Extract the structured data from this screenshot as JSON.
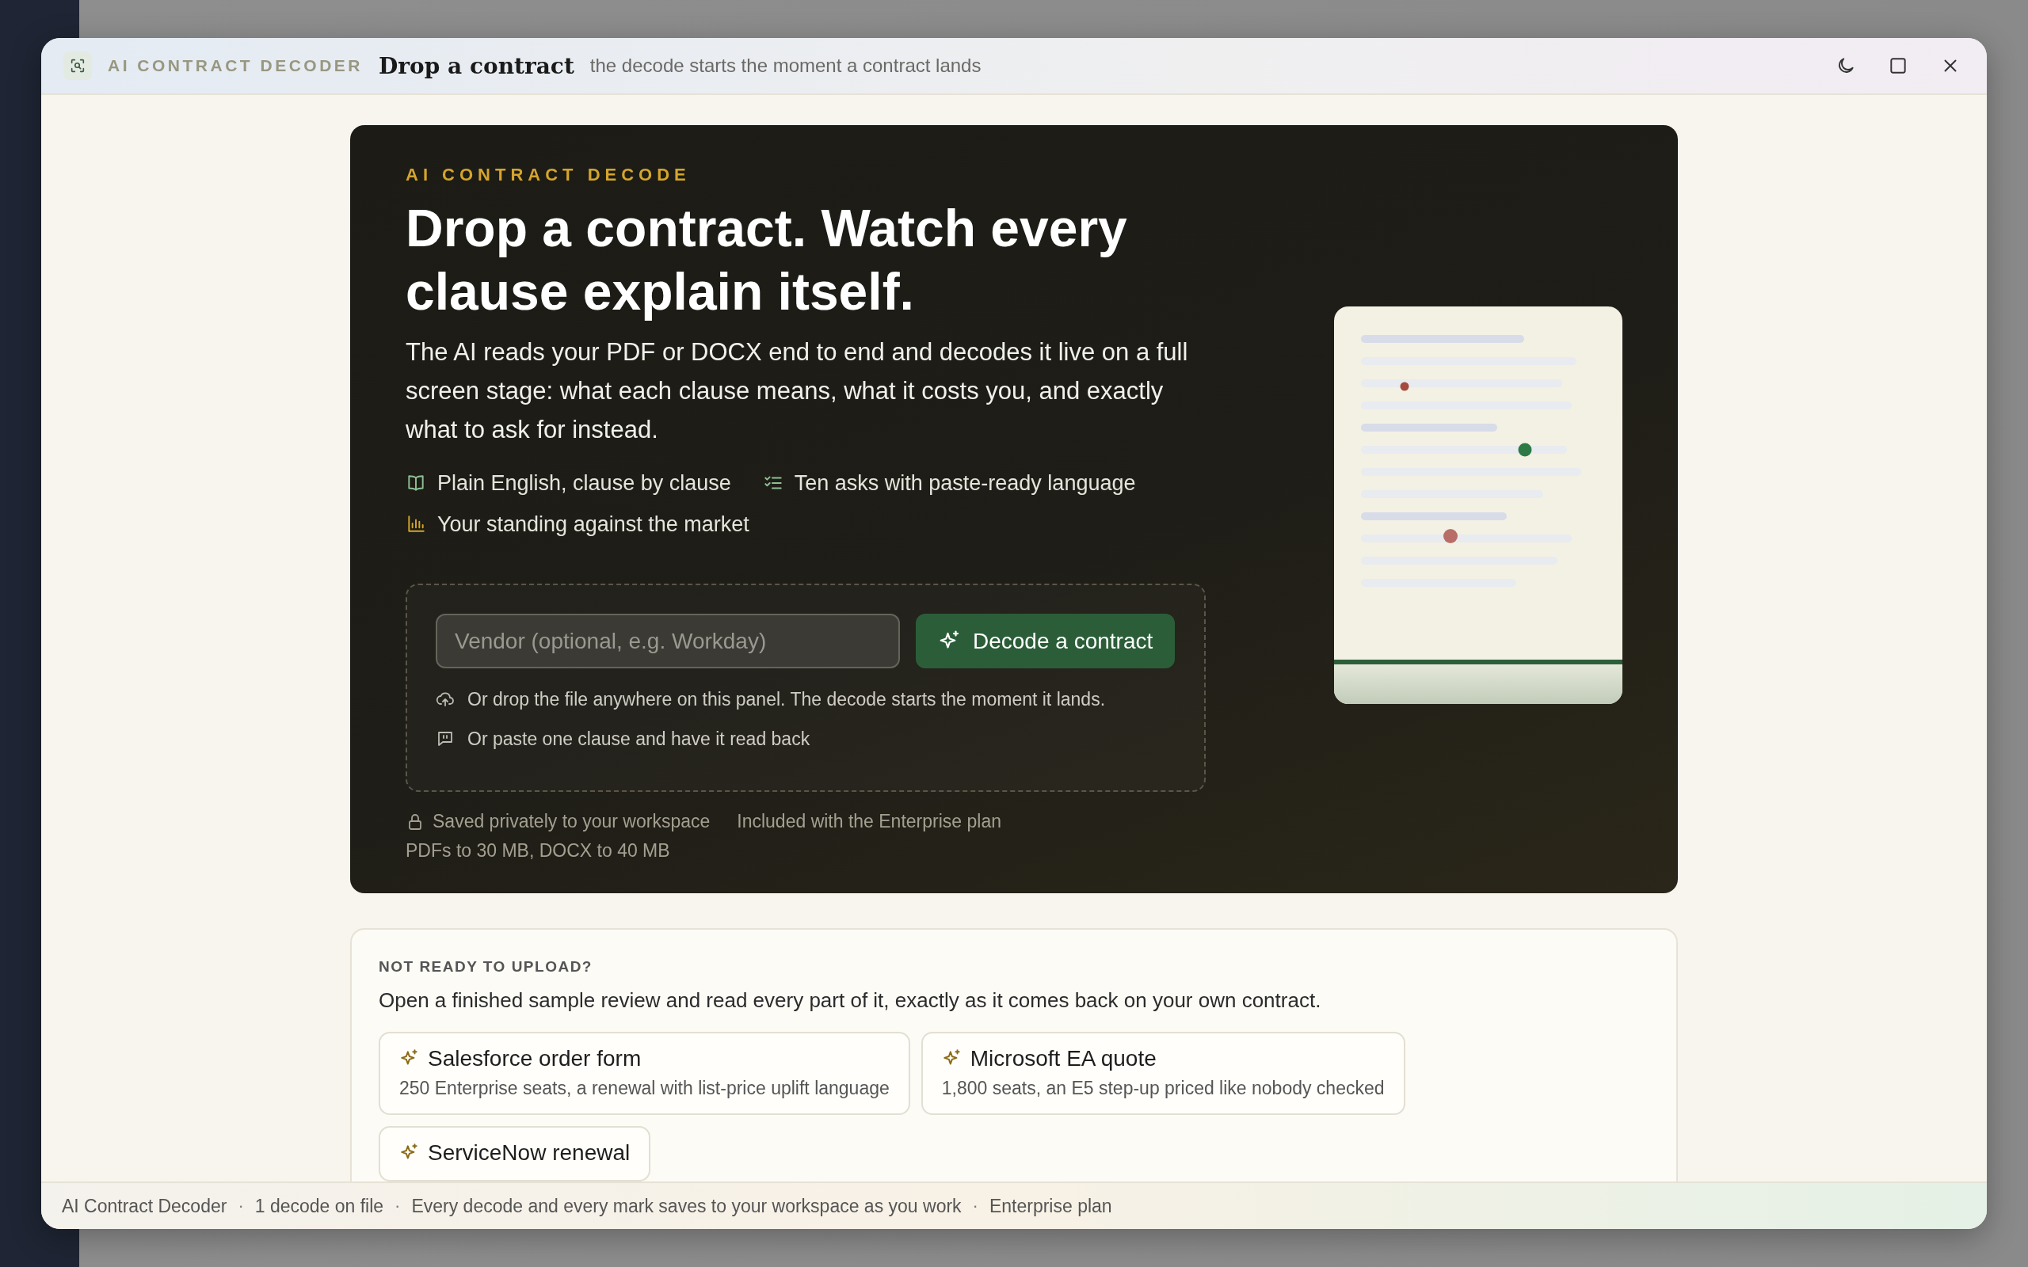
{
  "window": {
    "eyebrow": "AI CONTRACT DECODER",
    "title": "Drop a contract",
    "subtitle": "the decode starts the moment a contract lands",
    "controls": [
      {
        "kind": "theme"
      },
      {
        "kind": "maximize"
      },
      {
        "kind": "close"
      }
    ]
  },
  "hero": {
    "eyebrow": "AI CONTRACT DECODE",
    "headline": "Drop a contract. Watch every clause explain itself.",
    "description": "The AI reads your PDF or DOCX end to end and decodes it live on a full screen stage: what each clause means, what it costs you, and exactly what to ask for instead.",
    "features": [
      {
        "kind": "explain",
        "label": "Plain English, clause by clause"
      },
      {
        "kind": "asks",
        "label": "Ten asks with paste-ready language"
      },
      {
        "kind": "market",
        "label": "Your standing against the market"
      }
    ],
    "vendor_field": {
      "placeholder": "Vendor (optional, e.g. Workday)"
    },
    "decode_button": "Decode a contract",
    "hints": [
      {
        "kind": "drop",
        "text": "Or drop the file anywhere on this panel. The decode starts the moment it lands."
      },
      {
        "kind": "paste",
        "text": "Or paste one clause and have it read back"
      }
    ],
    "notes": [
      {
        "kind": "private",
        "text": "Saved privately to your workspace"
      },
      {
        "kind": "plain",
        "text": "Included with the Enterprise plan"
      },
      {
        "kind": "plain",
        "text": "PDFs to 30 MB, DOCX to 40 MB"
      }
    ]
  },
  "samples": {
    "eyebrow": "NOT READY TO UPLOAD?",
    "intro": "Open a finished sample review and read every part of it, exactly as it comes back on your own contract.",
    "items": [
      {
        "title": "Salesforce order form",
        "detail": "250 Enterprise seats, a renewal with list-price uplift language"
      },
      {
        "title": "Microsoft EA quote",
        "detail": "1,800 seats, an E5 step-up priced like nobody checked"
      },
      {
        "title": "ServiceNow renewal"
      }
    ]
  },
  "status_bar": {
    "separator": "·",
    "items": [
      "AI Contract Decoder",
      "1 decode on file",
      "Every decode and every mark saves to your workspace as you work",
      "Enterprise plan"
    ]
  }
}
